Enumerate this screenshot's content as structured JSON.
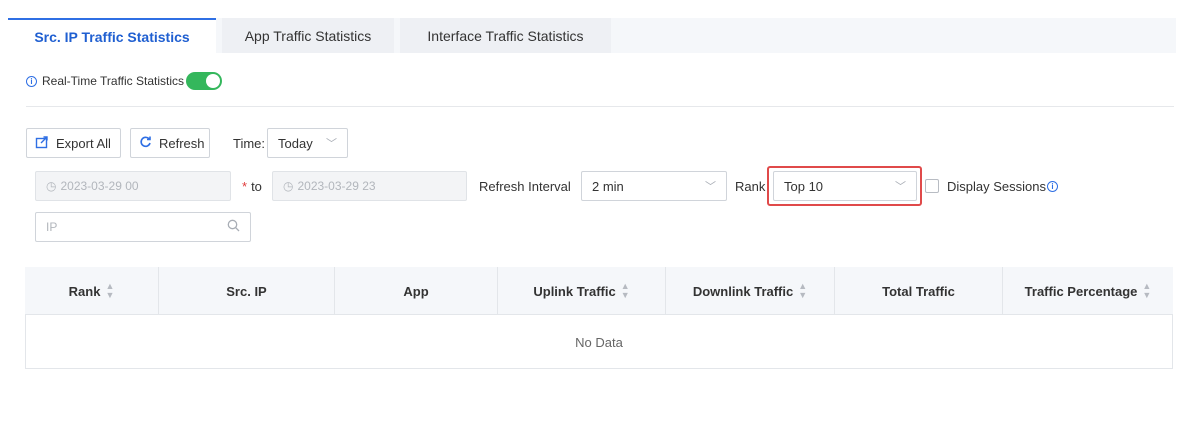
{
  "tabs": [
    {
      "label": "Src. IP Traffic Statistics",
      "active": true
    },
    {
      "label": "App Traffic Statistics",
      "active": false
    },
    {
      "label": "Interface Traffic Statistics",
      "active": false
    }
  ],
  "realtime": {
    "label": "Real-Time Traffic Statistics",
    "enabled": true
  },
  "toolbar": {
    "export_label": "Export All",
    "refresh_label": "Refresh",
    "time_label": "Time:",
    "time_value": "Today"
  },
  "filters": {
    "start_date": "2023-03-29 00",
    "required_mark": "*",
    "to_label": "to",
    "end_date": "2023-03-29 23",
    "refresh_interval_label": "Refresh Interval",
    "refresh_interval_value": "2 min",
    "rank_label": "Rank",
    "rank_value": "Top 10",
    "display_sessions_label": "Display Sessions",
    "ip_placeholder": "IP"
  },
  "table": {
    "columns": [
      {
        "label": "Rank",
        "sortable": true
      },
      {
        "label": "Src. IP",
        "sortable": false
      },
      {
        "label": "App",
        "sortable": false
      },
      {
        "label": "Uplink Traffic",
        "sortable": true
      },
      {
        "label": "Downlink Traffic",
        "sortable": true
      },
      {
        "label": "Total Traffic",
        "sortable": false
      },
      {
        "label": "Traffic Percentage",
        "sortable": true
      }
    ],
    "empty_text": "No Data"
  },
  "colors": {
    "accent": "#2f6fe4",
    "toggle_on": "#34b75c",
    "highlight": "#e04a4a"
  },
  "icons": {
    "info": "info-circle-icon",
    "export": "export-icon",
    "refresh": "refresh-icon",
    "clock": "clock-icon",
    "search": "search-icon",
    "chevron": "chevron-down-icon",
    "sort": "sort-icon"
  }
}
